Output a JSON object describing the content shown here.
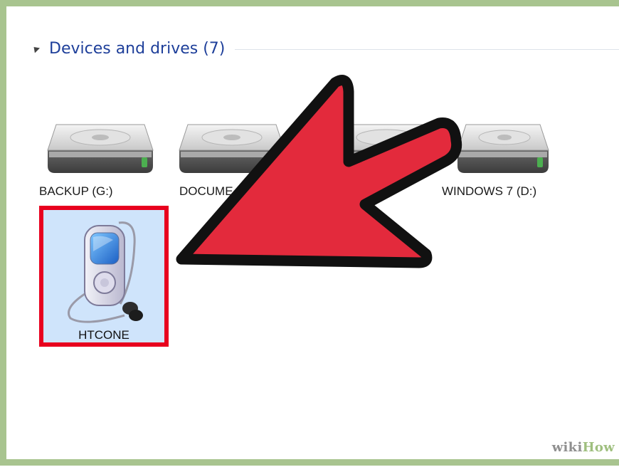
{
  "group": {
    "title": "Devices and drives (7)"
  },
  "drives": [
    {
      "label": "BACKUP (G:)",
      "icon": "hard-drive-icon"
    },
    {
      "label": "DOCUME",
      "icon": "hard-drive-icon"
    },
    {
      "label": ")",
      "icon": "hard-drive-icon"
    },
    {
      "label": "WINDOWS 7 (D:)",
      "icon": "hard-drive-icon"
    }
  ],
  "device": {
    "label": "HTCONE",
    "icon": "portable-media-player-icon",
    "highlight_color": "#e8001e"
  },
  "overlay": {
    "icon": "pointer-arrow-icon",
    "color": "#e32a3c"
  },
  "watermark": {
    "wiki": "wiki",
    "how": "How"
  },
  "colors": {
    "frame": "#a8c48f",
    "header_text": "#1e3f9a",
    "device_selection": "#cfe4fb"
  }
}
